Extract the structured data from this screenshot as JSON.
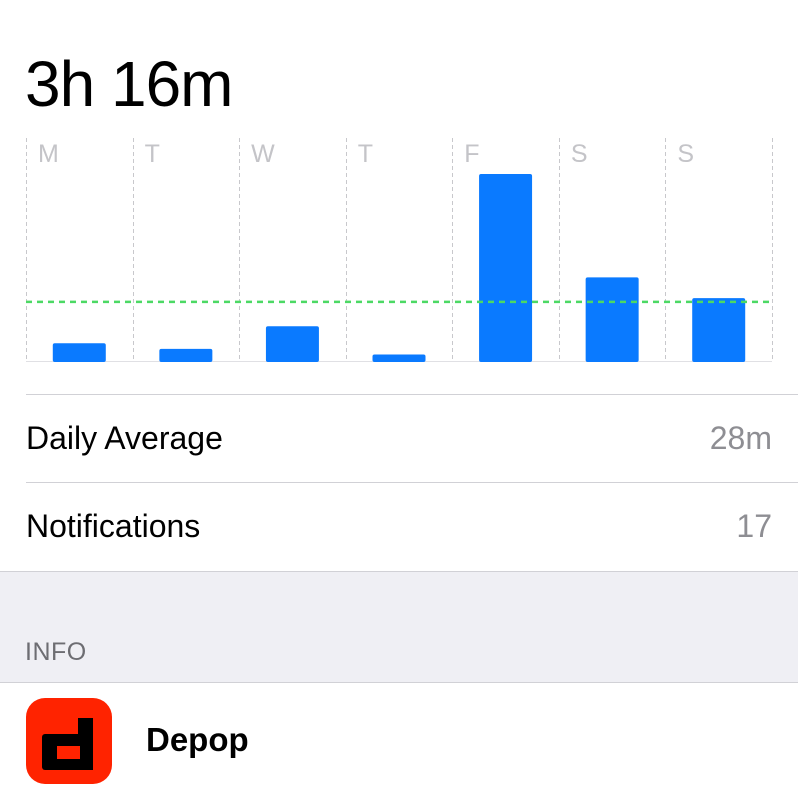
{
  "summary": {
    "total_time": "3h 16m"
  },
  "chart_data": {
    "type": "bar",
    "categories": [
      "M",
      "T",
      "W",
      "T",
      "F",
      "S",
      "S"
    ],
    "values": [
      0.1,
      0.07,
      0.19,
      0.04,
      1.0,
      0.45,
      0.34
    ],
    "average_line": 0.32,
    "colors": {
      "bar": "#0a7aff",
      "average": "#4cd964",
      "grid": "#c8c8cc"
    }
  },
  "stats": [
    {
      "label": "Daily Average",
      "value": "28m"
    },
    {
      "label": "Notifications",
      "value": "17"
    }
  ],
  "info_section": {
    "title": "INFO",
    "app": {
      "name": "Depop",
      "icon": "depop-logo",
      "icon_color": "#ff2300"
    }
  }
}
